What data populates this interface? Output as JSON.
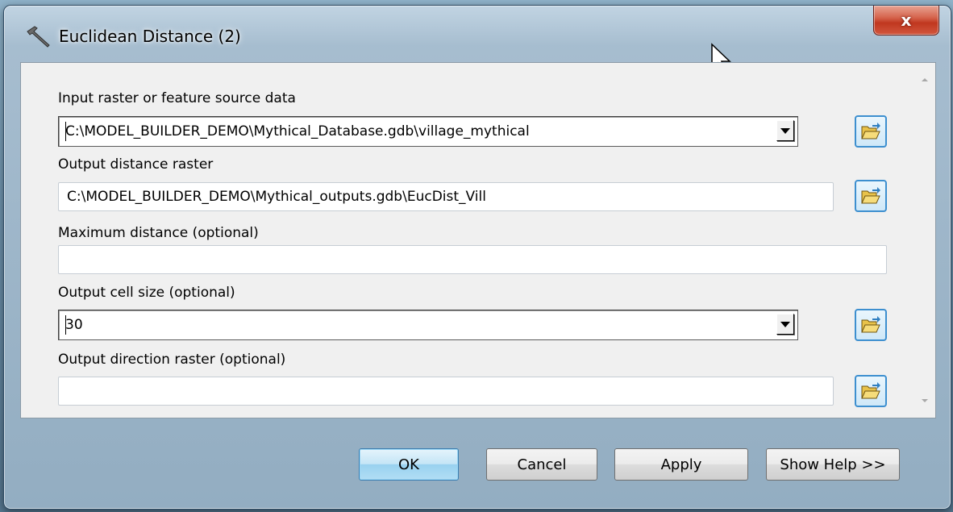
{
  "window": {
    "title": "Euclidean Distance (2)",
    "close_label": "x"
  },
  "fields": {
    "input_raster": {
      "label": "Input raster or feature source data",
      "value": "C:\\MODEL_BUILDER_DEMO\\Mythical_Database.gdb\\village_mythical"
    },
    "output_distance": {
      "label": "Output distance raster",
      "value": "C:\\MODEL_BUILDER_DEMO\\Mythical_outputs.gdb\\EucDist_Vill"
    },
    "max_distance": {
      "label": "Maximum distance (optional)",
      "value": ""
    },
    "cell_size": {
      "label": "Output cell size (optional)",
      "value": "30"
    },
    "direction_raster": {
      "label": "Output direction raster (optional)",
      "value": ""
    }
  },
  "buttons": {
    "ok": "OK",
    "cancel": "Cancel",
    "apply": "Apply",
    "help": "Show Help >>"
  },
  "icons": {
    "title": "hammer-icon",
    "browse": "open-folder-icon",
    "cursor": "mouse-pointer-icon"
  },
  "colors": {
    "accent": "#3d8fcf",
    "close": "#c0371f"
  }
}
